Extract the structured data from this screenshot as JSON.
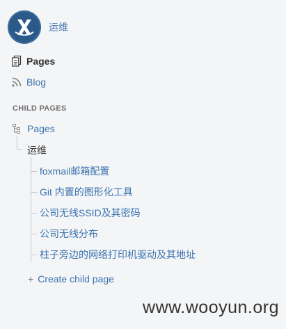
{
  "space": {
    "name": "运维"
  },
  "nav": {
    "pages_label": "Pages",
    "blog_label": "Blog"
  },
  "child_pages": {
    "section_title": "CHILD PAGES",
    "root_label": "Pages",
    "current_page": "运维",
    "children": [
      "foxmail邮箱配置",
      "Git 内置的图形化工具",
      "公司无线SSID及其密码",
      "公司无线分布",
      "柱子旁边的网络打印机驱动及其地址"
    ],
    "create_label": "Create child page"
  },
  "watermark": "www.wooyun.org",
  "colors": {
    "link": "#3b73af",
    "background": "#f4f5f7",
    "logo_bg": "#2b5a8a"
  }
}
